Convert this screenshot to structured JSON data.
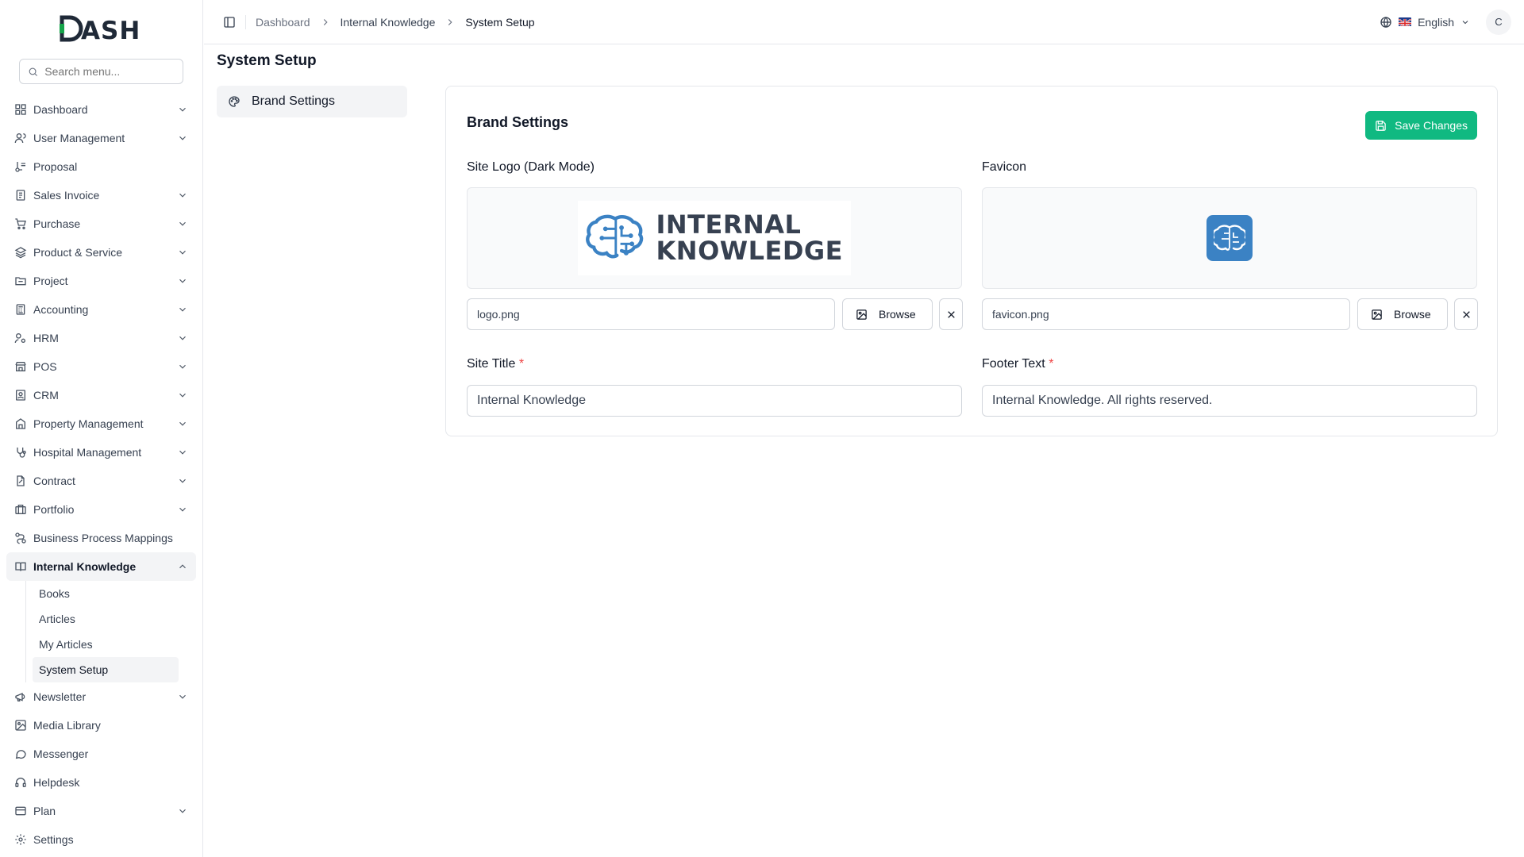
{
  "app": {
    "logo_text": "DASH"
  },
  "sidebar": {
    "search_placeholder": "Search menu...",
    "items": [
      {
        "label": "Dashboard",
        "icon": "dashboard-grid-icon",
        "has_chevron": true
      },
      {
        "label": "User Management",
        "icon": "users-icon",
        "has_chevron": true
      },
      {
        "label": "Proposal",
        "icon": "proposal-icon",
        "has_chevron": false
      },
      {
        "label": "Sales Invoice",
        "icon": "invoice-icon",
        "has_chevron": true
      },
      {
        "label": "Purchase",
        "icon": "cart-icon",
        "has_chevron": true
      },
      {
        "label": "Product & Service",
        "icon": "layers-icon",
        "has_chevron": true
      },
      {
        "label": "Project",
        "icon": "folder-icon",
        "has_chevron": true
      },
      {
        "label": "Accounting",
        "icon": "calculator-icon",
        "has_chevron": true
      },
      {
        "label": "HRM",
        "icon": "hrm-icon",
        "has_chevron": true
      },
      {
        "label": "POS",
        "icon": "store-icon",
        "has_chevron": true
      },
      {
        "label": "CRM",
        "icon": "contact-icon",
        "has_chevron": true
      },
      {
        "label": "Property Management",
        "icon": "property-icon",
        "has_chevron": true
      },
      {
        "label": "Hospital Management",
        "icon": "stethoscope-icon",
        "has_chevron": true
      },
      {
        "label": "Contract",
        "icon": "contract-icon",
        "has_chevron": true
      },
      {
        "label": "Portfolio",
        "icon": "briefcase-icon",
        "has_chevron": true
      },
      {
        "label": "Business Process Mappings",
        "icon": "workflow-icon",
        "has_chevron": false
      },
      {
        "label": "Internal Knowledge",
        "icon": "book-icon",
        "has_chevron": true,
        "expanded": true
      },
      {
        "label": "Newsletter",
        "icon": "megaphone-icon",
        "has_chevron": true
      },
      {
        "label": "Media Library",
        "icon": "image-icon",
        "has_chevron": false
      },
      {
        "label": "Messenger",
        "icon": "chat-icon",
        "has_chevron": false
      },
      {
        "label": "Helpdesk",
        "icon": "headset-icon",
        "has_chevron": false
      },
      {
        "label": "Plan",
        "icon": "card-icon",
        "has_chevron": true
      },
      {
        "label": "Settings",
        "icon": "gear-icon",
        "has_chevron": false
      }
    ],
    "sub_items": [
      {
        "label": "Books"
      },
      {
        "label": "Articles"
      },
      {
        "label": "My Articles"
      },
      {
        "label": "System Setup",
        "active": true
      }
    ]
  },
  "header": {
    "breadcrumbs": [
      "Dashboard",
      "Internal Knowledge",
      "System Setup"
    ],
    "language": "English",
    "avatar_initial": "C"
  },
  "page": {
    "title": "System Setup",
    "settings_nav": {
      "label": "Brand Settings"
    }
  },
  "brand_settings": {
    "title": "Brand Settings",
    "save_label": "Save Changes",
    "site_logo": {
      "label": "Site Logo (Dark Mode)",
      "filename": "logo.png",
      "browse_label": "Browse",
      "logo_line1": "INTERNAL",
      "logo_line2": "KNOWLEDGE"
    },
    "favicon": {
      "label": "Favicon",
      "filename": "favicon.png",
      "browse_label": "Browse"
    },
    "site_title": {
      "label": "Site Title",
      "value": "Internal Knowledge",
      "required_mark": "*"
    },
    "footer_text": {
      "label": "Footer Text",
      "value": "Internal Knowledge. All rights reserved.",
      "required_mark": "*"
    }
  },
  "colors": {
    "accent": "#10b981",
    "brand_green": "#16a34a",
    "logo_blue": "#3b82c4"
  }
}
